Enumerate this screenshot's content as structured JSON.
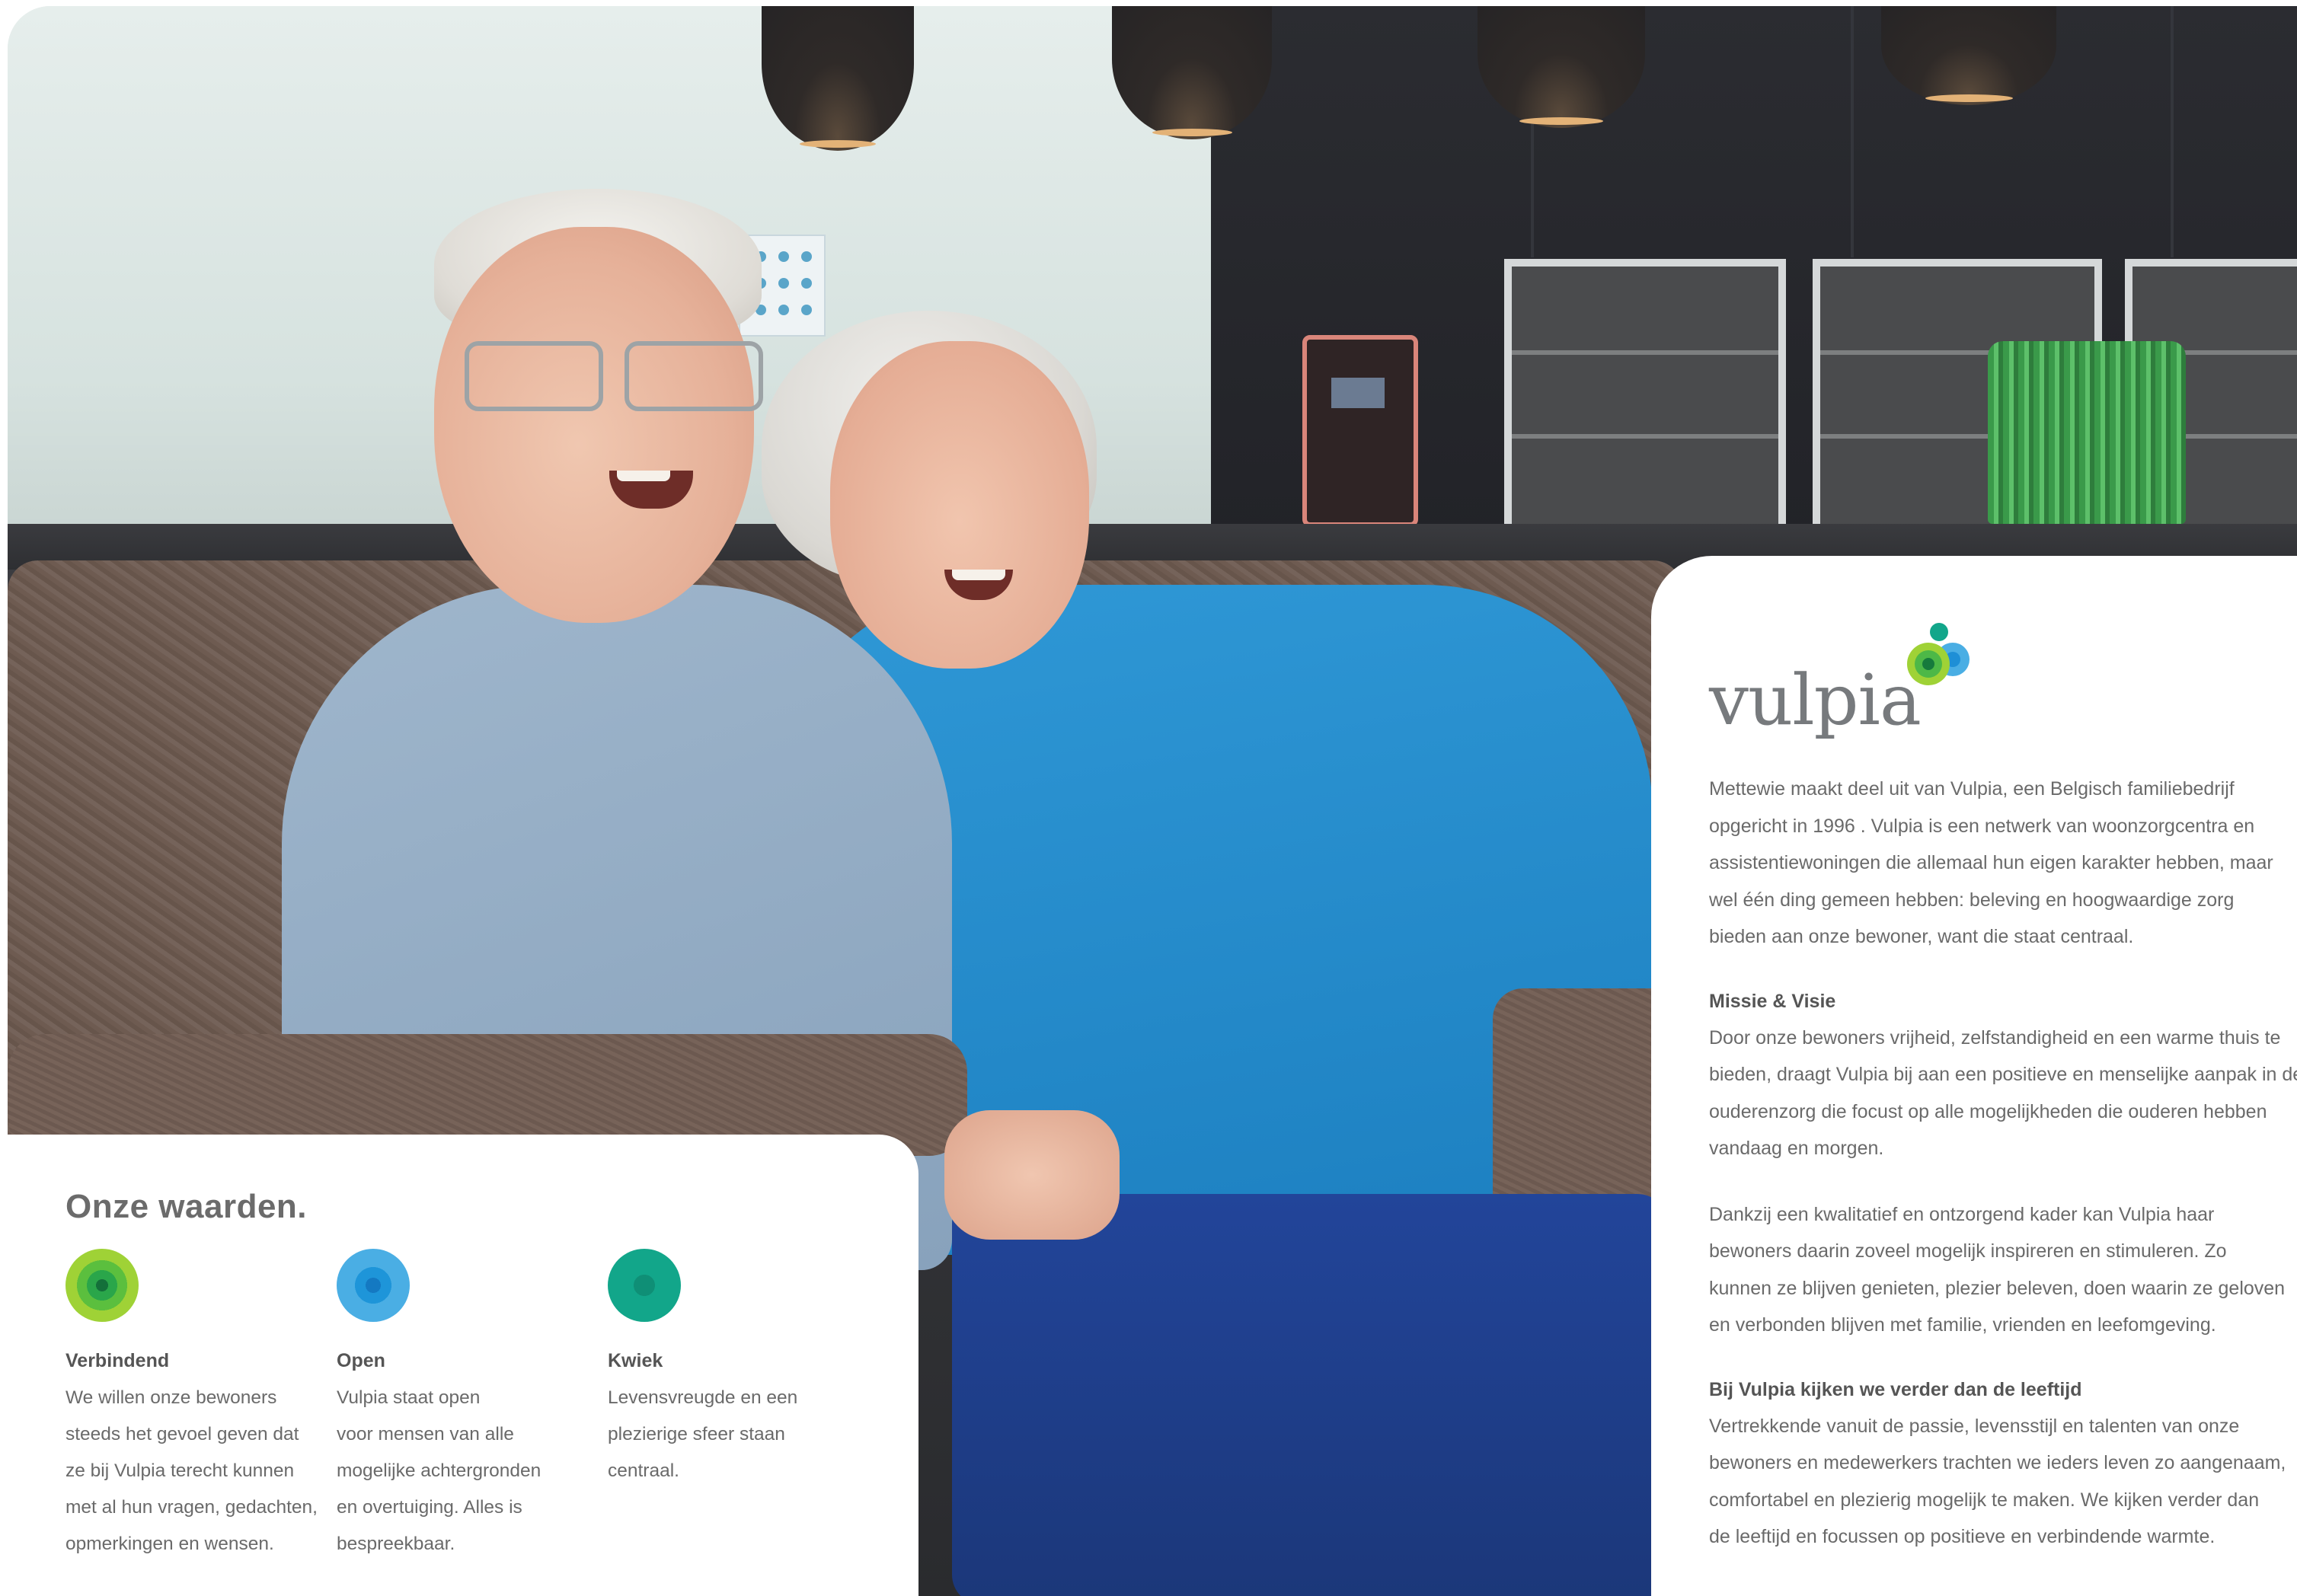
{
  "values_section": {
    "title": "Onze waarden.",
    "items": [
      {
        "name": "Verbindend",
        "text": "We willen onze bewoners\nsteeds het gevoel geven dat\nze bij Vulpia terecht kunnen\nmet al hun vragen, gedachten,\nopmerkingen en wensen.",
        "icon": "concentric-green-circles-icon"
      },
      {
        "name": "Open",
        "text": "Vulpia staat open\nvoor mensen van alle\nmogelijke achtergronden\nen overtuiging. Alles is\nbespreekbaar.",
        "icon": "concentric-blue-circles-icon"
      },
      {
        "name": "Kwiek",
        "text": "Levensvreugde en een\nplezierige sfeer staan\ncentraal.",
        "icon": "concentric-teal-circles-icon"
      }
    ]
  },
  "info_card": {
    "logo_text": "vulpia",
    "intro": "Mettewie maakt deel uit van Vulpia, een Belgisch familiebedrijf\nopgericht in 1996 . Vulpia is een netwerk van woonzorgcentra en\nassistentiewoningen die allemaal hun eigen karakter hebben, maar\nwel één ding gemeen hebben: beleving en hoogwaardige zorg\nbieden aan onze bewoner, want die staat centraal.",
    "mission_heading": "Missie & Visie",
    "mission_p1": "Door onze bewoners vrijheid, zelfstandigheid en een warme thuis te\nbieden, draagt Vulpia bij aan een positieve en menselijke aanpak in de\nouderenzorg die focust op alle mogelijkheden die ouderen hebben\nvandaag en morgen.",
    "mission_p2": "Dankzij een kwalitatief en ontzorgend kader kan Vulpia haar\nbewoners daarin zoveel mogelijk inspireren en stimuleren. Zo\nkunnen ze blijven genieten, plezier beleven, doen waarin ze geloven\nen verbonden blijven met familie, vrienden en leefomgeving.",
    "age_heading": "Bij Vulpia kijken we verder dan de leeftijd",
    "age_p": "Vertrekkende vanuit de passie, levensstijl en talenten van onze\nbewoners en medewerkers trachten we ieders leven zo aangenaam,\ncomfortabel en plezierig mogelijk te maken. We kijken verder dan\nde leeftijd en focussen op positieve en verbindende warmte."
  },
  "colors": {
    "heading_gray": "#6b6b6b",
    "text_gray": "#6a6a6a",
    "green": "#7fc241",
    "blue": "#3aa7e0",
    "teal": "#12a68a"
  }
}
